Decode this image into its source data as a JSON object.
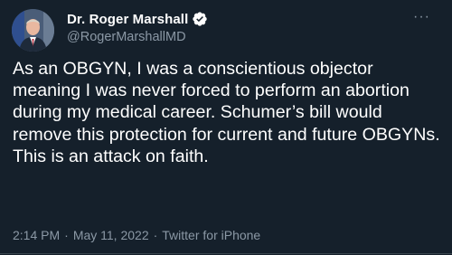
{
  "author": {
    "display_name": "Dr. Roger Marshall",
    "handle": "@RogerMarshallMD",
    "verified": true,
    "verified_icon": "verified-badge-icon"
  },
  "tweet": {
    "text": "As an OBGYN, I was a conscientious objector meaning I was never forced to perform an abortion during my medical career. Schumer’s bill would remove this protection for current and future OBGYNs. This is an attack on faith.",
    "time": "2:14 PM",
    "date": "May 11, 2022",
    "source": "Twitter for iPhone",
    "separator": "·"
  },
  "menu": {
    "more_icon": "more-options-icon",
    "more_glyph": "···"
  },
  "colors": {
    "background": "#15202b",
    "primary_text": "#ffffff",
    "secondary_text": "#8b98a5",
    "verified_blue": "#1d9bf0"
  }
}
